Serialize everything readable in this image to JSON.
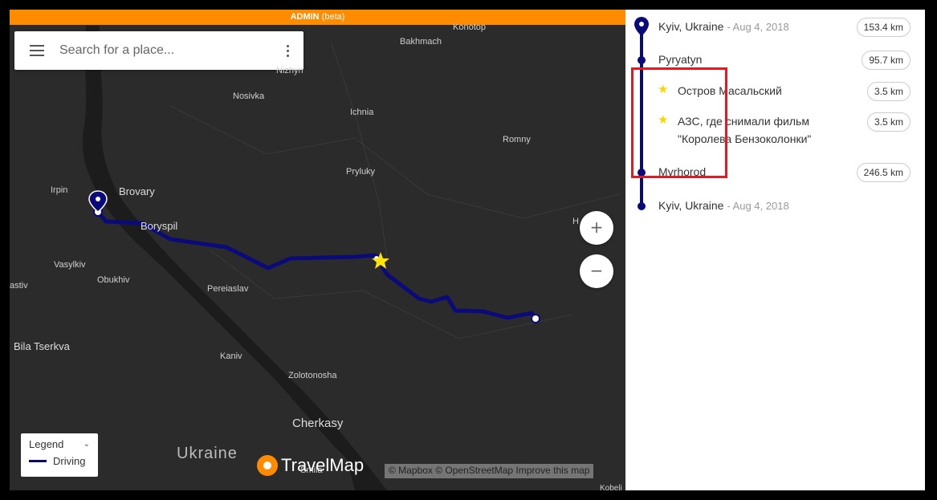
{
  "admin_bar": {
    "label": "ADMIN",
    "suffix": "(beta)"
  },
  "search": {
    "placeholder": "Search for a place..."
  },
  "map_labels": {
    "places": [
      "Konotop",
      "Bakhmach",
      "Nizhyn",
      "Nosivka",
      "Ichnia",
      "Romny",
      "Pryluky",
      "Irpin",
      "Brovary",
      "Boryspil",
      "Vasylkiv",
      "Obukhiv",
      "Pereiaslav",
      "Bila Tserkva",
      "Kaniv",
      "Zolotonosha",
      "Cherkasy",
      "astiv",
      "H",
      "Smila",
      "Kobeli"
    ],
    "country": "Ukraine"
  },
  "zoom": {
    "in": "+",
    "out": "−"
  },
  "legend": {
    "title": "Legend",
    "item": "Driving",
    "route_color": "#0a0a6e"
  },
  "brand": "TravelMap",
  "attribution": "© Mapbox © OpenStreetMap Improve this map",
  "itinerary": {
    "stops": [
      {
        "name": "Kyiv, Ukraine",
        "date": "- Aug 4, 2018",
        "distance": "153.4 km"
      },
      {
        "name": "Pyryatyn",
        "distance": "95.7 km"
      },
      {
        "name": "Остров Масальский",
        "distance": "3.5 km"
      },
      {
        "name": "АЗС, где снимали фильм \"Королева Бензоколонки\"",
        "distance": "3.5 km"
      },
      {
        "name": "Myrhorod",
        "distance": "246.5 km"
      },
      {
        "name": "Kyiv, Ukraine",
        "date": "- Aug 4, 2018"
      }
    ]
  },
  "colors": {
    "accent": "#ff8c00",
    "route": "#0a0a7a",
    "highlight": "#e01b24",
    "star": "#ffd400"
  }
}
